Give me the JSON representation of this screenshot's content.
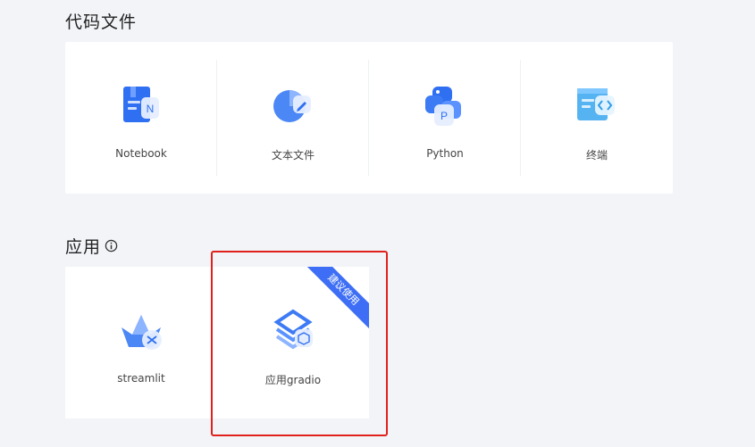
{
  "sections": {
    "code": {
      "title": "代码文件",
      "items": [
        {
          "label": "Notebook",
          "icon": "notebook-icon"
        },
        {
          "label": "文本文件",
          "icon": "text-file-icon"
        },
        {
          "label": "Python",
          "icon": "python-icon"
        },
        {
          "label": "终端",
          "icon": "terminal-icon"
        }
      ]
    },
    "apps": {
      "title": "应用",
      "info_icon": "info-icon",
      "items": [
        {
          "label": "streamlit",
          "icon": "streamlit-icon"
        },
        {
          "label": "应用gradio",
          "icon": "gradio-icon",
          "badge": "建议使用"
        }
      ]
    }
  },
  "colors": {
    "accent": "#3d6ef5",
    "highlight_border": "#e0201a",
    "background": "#f3f4f8"
  }
}
